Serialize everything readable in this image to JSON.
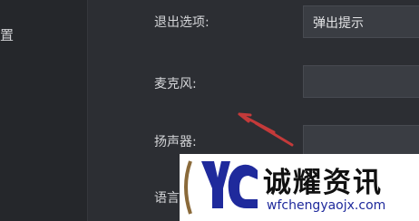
{
  "sidebar": {
    "label": "置"
  },
  "settings": {
    "exit_option": {
      "label": "退出选项:",
      "value": "弹出提示"
    },
    "microphone": {
      "label": "麦克风:",
      "value": ""
    },
    "speaker": {
      "label": "扬声器:",
      "value": ""
    },
    "language": {
      "label": "语言"
    }
  },
  "watermark": {
    "title": "诚耀资讯",
    "url": "wfchengyaojx.com",
    "logo_icon": "yc-logo-icon"
  },
  "colors": {
    "background": "#2c2e33",
    "sidebar": "#25272b",
    "field": "#3a3d43",
    "arrow": "#c43a3a",
    "logo_blue": "#1f2a9c"
  }
}
